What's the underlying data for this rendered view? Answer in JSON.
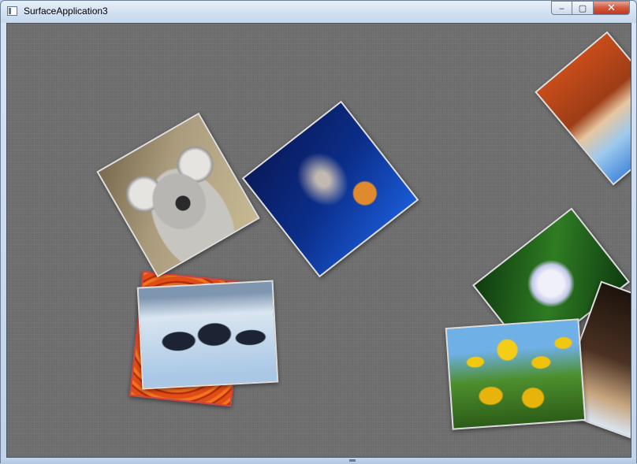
{
  "window": {
    "title": "SurfaceApplication3",
    "controls": {
      "minimize": "‒",
      "maximize": "▢",
      "close": "✕"
    }
  },
  "surface": {
    "background_color": "#6e6e6e",
    "photos": [
      {
        "subject": "koala"
      },
      {
        "subject": "jellyfish"
      },
      {
        "subject": "orange-flower"
      },
      {
        "subject": "penguins"
      },
      {
        "subject": "desert"
      },
      {
        "subject": "hydrangeas"
      },
      {
        "subject": "lighthouse"
      },
      {
        "subject": "tulips"
      }
    ]
  },
  "colors": {
    "titlebar": "#d4e2f2",
    "close_button": "#c0391c",
    "surface": "#6e6e6e"
  }
}
